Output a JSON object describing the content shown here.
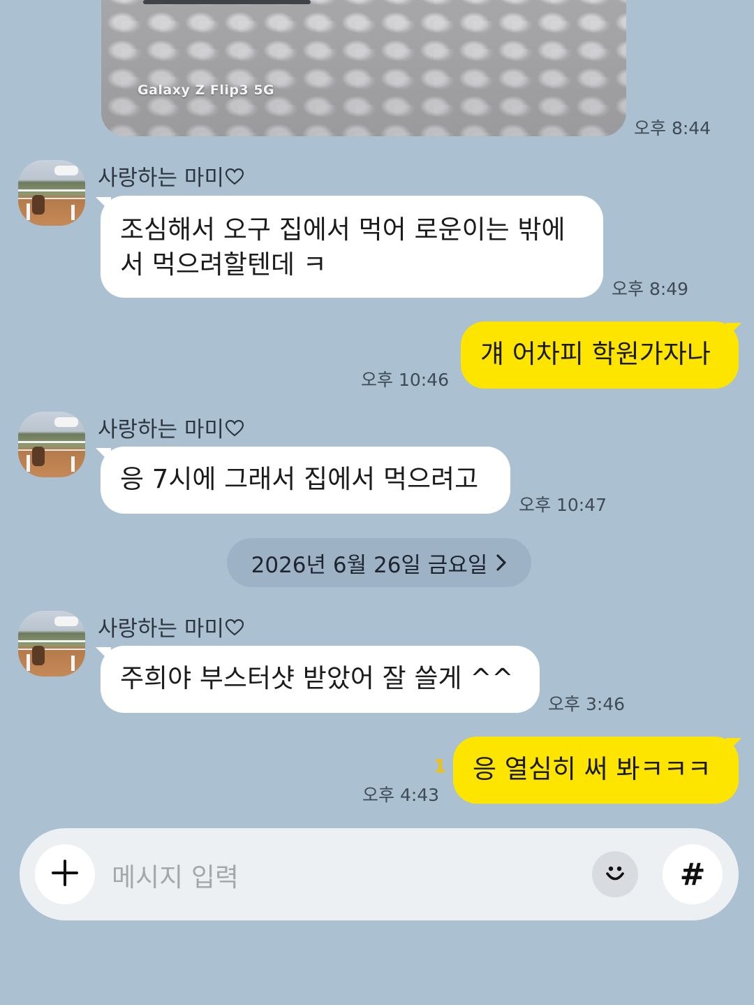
{
  "photo": {
    "caption": "Galaxy Z Flip3 5G",
    "time": "오후 8:44"
  },
  "messages": [
    {
      "sender": "사랑하는 마미",
      "line1": "조심해서 오구 집에서 먹어 로운이는 밖에",
      "line2": "서 먹으려할텐데 ㅋ",
      "time": "오후 8:49"
    },
    {
      "text": "걔 어차피 학원가자나",
      "time": "오후 10:46"
    },
    {
      "sender": "사랑하는 마미",
      "text": "응 7시에 그래서 집에서 먹으려고",
      "time": "오후 10:47"
    },
    {
      "sender": "사랑하는 마미",
      "text": "주희야 부스터샷 받았어 잘 쓸게 ^^",
      "time": "오후 3:46"
    },
    {
      "text": "응 열심히 써 봐ㅋㅋㅋ",
      "time": "오후 4:43",
      "unread": "1"
    }
  ],
  "date_divider": "2026년 6월 26일 금요일",
  "composer": {
    "placeholder": "메시지 입력",
    "hash_label": "#"
  },
  "colors": {
    "background": "#abc1d1",
    "incoming_bubble": "#ffffff",
    "outgoing_bubble": "#fee500",
    "unread_count": "#f0c20a"
  },
  "icons": {
    "sender_heart": "heart-outline-icon",
    "date_chevron": "chevron-right-icon",
    "attach": "plus-icon",
    "emoji": "smile-icon",
    "hashtag": "hash-icon"
  }
}
